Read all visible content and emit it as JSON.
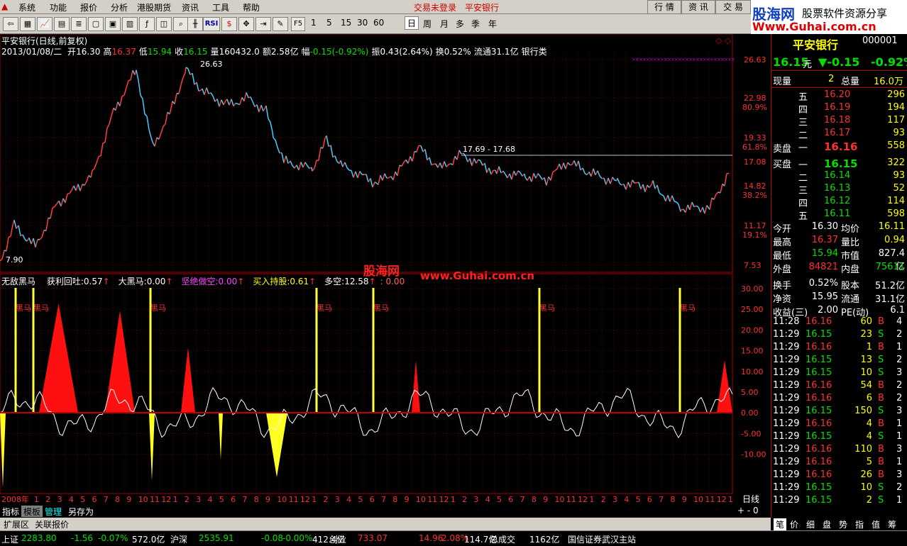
{
  "menu": {
    "items": [
      "系统",
      "功能",
      "报价",
      "分析",
      "港股期货",
      "资讯",
      "工具",
      "帮助"
    ],
    "login_status": "交易未登录",
    "stock_name": "平安银行",
    "right_buttons": [
      "行 情",
      "资 讯",
      "交 易"
    ]
  },
  "brand": {
    "logo": "股海网",
    "tagline": "股票软件资源分享",
    "url": "Www.Guhai.com.cn"
  },
  "toolbar": {
    "indicator_btn": "RSI",
    "key_btn": "F5",
    "periods": [
      "1",
      "5",
      "15",
      "30",
      "60",
      "日",
      "周",
      "月",
      "多",
      "季",
      "年"
    ]
  },
  "chart": {
    "title": "平安银行(日线,前复权)",
    "date_day": "2013/01/08/二",
    "stats": [
      {
        "label": "开",
        "value": "16.30",
        "color": "#ffffff"
      },
      {
        "label": "高",
        "value": "16.37",
        "color": "#ff3030"
      },
      {
        "label": "低",
        "value": "15.94",
        "color": "#00e000"
      },
      {
        "label": "收",
        "value": "16.15",
        "color": "#00e000"
      },
      {
        "label": "量",
        "value": "160432.0",
        "color": "#ffffff"
      },
      {
        "label": "额",
        "value": "2.58亿",
        "color": "#ffffff"
      },
      {
        "label": "幅",
        "value": "-0.15(-0.92%)",
        "color": "#00e000"
      },
      {
        "label": "振",
        "value": "0.43(2.64%)",
        "color": "#ffffff"
      },
      {
        "label": "换",
        "value": "0.52%",
        "color": "#ffffff"
      },
      {
        "label": "流通",
        "value": "31.1亿",
        "color": "#ffffff"
      },
      {
        "label": "",
        "value": "银行类",
        "color": "#ffffff"
      }
    ],
    "price_axis": [
      {
        "v": "26.63",
        "pct": ""
      },
      {
        "v": "22.98",
        "pct": "80.9%"
      },
      {
        "v": "19.33",
        "pct": "61.8%"
      },
      {
        "v": "17.08",
        "pct": ""
      },
      {
        "v": "14.82",
        "pct": "38.2%"
      },
      {
        "v": "11.17",
        "pct": "19.1%"
      },
      {
        "v": "7.53",
        "pct": ""
      }
    ],
    "max_label": "26.63",
    "min_label": "7.90",
    "range_label": "17.69 - 17.68",
    "watermark_site": "股海网",
    "watermark_url": "www.Guhai.com.cn"
  },
  "indicator": {
    "name": "无敌黑马",
    "items": [
      {
        "label": "获利回吐:",
        "value": "0.57",
        "color": "#ffffff"
      },
      {
        "label": "大黑马:",
        "value": "0.00",
        "color": "#ffffff"
      },
      {
        "label": "坚绝做空:",
        "value": "0.00",
        "color": "#ff40ff"
      },
      {
        "label": "买入持股:",
        "value": "0.61",
        "color": "#ffff00"
      },
      {
        "label": "多空:",
        "value": "12.58",
        "color": "#ffffff"
      }
    ],
    "tail": ": 0.00",
    "axis": [
      "30.00",
      "25.00",
      "20.00",
      "15.00",
      "10.00",
      "5.00",
      "0.00",
      "-5.00",
      "-10.00"
    ],
    "signal_label": "黑马"
  },
  "timeline": {
    "year": "2008年",
    "months": [
      "1",
      "2",
      "3",
      "4",
      "5",
      "6",
      "7",
      "8",
      "9",
      "10",
      "11",
      "12",
      "1",
      "2",
      "3",
      "4",
      "5",
      "6",
      "7",
      "8",
      "9",
      "10",
      "11",
      "12",
      "1",
      "2",
      "3",
      "4",
      "5",
      "6",
      "7",
      "8",
      "9",
      "10",
      "11",
      "12",
      "1",
      "2",
      "3",
      "4",
      "5",
      "6",
      "7",
      "8",
      "9",
      "10",
      "11",
      "12",
      "1",
      "2",
      "3",
      "4",
      "5",
      "6",
      "7",
      "8",
      "9",
      "10",
      "11",
      "12",
      "1"
    ],
    "period": "日线"
  },
  "tabs": [
    "指标",
    "模板",
    "管理",
    "另存为"
  ],
  "tabs2": [
    "扩展区",
    "关联报价"
  ],
  "quote": {
    "name": "平安银行",
    "code": "000001",
    "price": "16.15",
    "unit": "元",
    "change": "▼-0.15",
    "pct": "-0.92%",
    "vol_now_label": "现量",
    "vol_now": "2",
    "vol_total_label": "总量",
    "vol_total": "16.0万",
    "asks": [
      {
        "lbl": "五",
        "p": "16.20",
        "v": "296"
      },
      {
        "lbl": "四",
        "p": "16.19",
        "v": "194"
      },
      {
        "lbl": "三",
        "p": "16.18",
        "v": "117"
      },
      {
        "lbl": "二",
        "p": "16.17",
        "v": "93"
      },
      {
        "lbl": "一",
        "p": "16.16",
        "v": "558"
      }
    ],
    "ask_label": "卖盘",
    "bid_label": "买盘",
    "bids": [
      {
        "lbl": "一",
        "p": "16.15",
        "v": "322"
      },
      {
        "lbl": "二",
        "p": "16.14",
        "v": "93"
      },
      {
        "lbl": "三",
        "p": "16.13",
        "v": "52"
      },
      {
        "lbl": "四",
        "p": "16.12",
        "v": "114"
      },
      {
        "lbl": "五",
        "p": "16.11",
        "v": "598"
      }
    ],
    "info": [
      {
        "l1": "今开",
        "v1": "16.30",
        "c1": "#ffffff",
        "l2": "均价",
        "v2": "16.11",
        "c2": "#ffff00"
      },
      {
        "l1": "最高",
        "v1": "16.37",
        "c1": "#ff3030",
        "l2": "量比",
        "v2": "0.94",
        "c2": "#ffff00"
      },
      {
        "l1": "最低",
        "v1": "15.94",
        "c1": "#00e000",
        "l2": "市值",
        "v2": "827.4亿",
        "c2": "#ffffff"
      },
      {
        "l1": "外盘",
        "v1": "84821",
        "c1": "#ff3030",
        "l2": "内盘",
        "v2": "75611",
        "c2": "#00e000"
      },
      {
        "l1": "换手",
        "v1": "0.52%",
        "c1": "#ffffff",
        "l2": "股本",
        "v2": "51.2亿",
        "c2": "#ffffff"
      },
      {
        "l1": "净资",
        "v1": "15.95",
        "c1": "#ffffff",
        "l2": "流通",
        "v2": "31.1亿",
        "c2": "#ffffff"
      },
      {
        "l1": "收益(三)",
        "v1": "2.00",
        "c1": "#ffffff",
        "l2": "PE(动)",
        "v2": "6.1",
        "c2": "#ffffff"
      }
    ],
    "ticks": [
      {
        "t": "11:28",
        "p": "16.16",
        "v": "60",
        "s": "B",
        "n": "4"
      },
      {
        "t": "11:29",
        "p": "16.15",
        "v": "23",
        "s": "S",
        "n": "2"
      },
      {
        "t": "11:29",
        "p": "16.16",
        "v": "1",
        "s": "B",
        "n": "1"
      },
      {
        "t": "11:29",
        "p": "16.15",
        "v": "13",
        "s": "S",
        "n": "2"
      },
      {
        "t": "11:29",
        "p": "16.15",
        "v": "10",
        "s": "S",
        "n": "3"
      },
      {
        "t": "11:29",
        "p": "16.16",
        "v": "54",
        "s": "B",
        "n": "2"
      },
      {
        "t": "11:29",
        "p": "16.16",
        "v": "6",
        "s": "B",
        "n": "2"
      },
      {
        "t": "11:29",
        "p": "16.15",
        "v": "150",
        "s": "S",
        "n": "3"
      },
      {
        "t": "11:29",
        "p": "16.16",
        "v": "4",
        "s": "B",
        "n": "1"
      },
      {
        "t": "11:29",
        "p": "16.15",
        "v": "4",
        "s": "S",
        "n": "1"
      },
      {
        "t": "11:29",
        "p": "16.16",
        "v": "110",
        "s": "B",
        "n": "3"
      },
      {
        "t": "11:29",
        "p": "16.16",
        "v": "5",
        "s": "B",
        "n": "1"
      },
      {
        "t": "11:29",
        "p": "16.16",
        "v": "26",
        "s": "B",
        "n": "3"
      },
      {
        "t": "11:29",
        "p": "16.15",
        "v": "10",
        "s": "S",
        "n": "2"
      },
      {
        "t": "11:29",
        "p": "16.15",
        "v": "2",
        "s": "S",
        "n": "1"
      }
    ],
    "bottom_tabs": [
      "笔",
      "价",
      "细",
      "盘",
      "势",
      "指",
      "值",
      "筹"
    ]
  },
  "status": {
    "items": [
      {
        "name": "上证",
        "price": "2283.80",
        "chg": "-1.56",
        "pct": "-0.07%",
        "amt": "572.0亿"
      },
      {
        "name": "沪深",
        "price": "2535.91",
        "chg": "-0.08",
        "pct": "-0.00%",
        "amt": "412.4亿"
      },
      {
        "name": "创业",
        "price": "733.07",
        "chg": "14.96",
        "pct": "2.08%",
        "amt": "114.7亿"
      }
    ],
    "total_label": "总成交",
    "total": "1162亿",
    "server": "国信证券武汉主站"
  }
}
